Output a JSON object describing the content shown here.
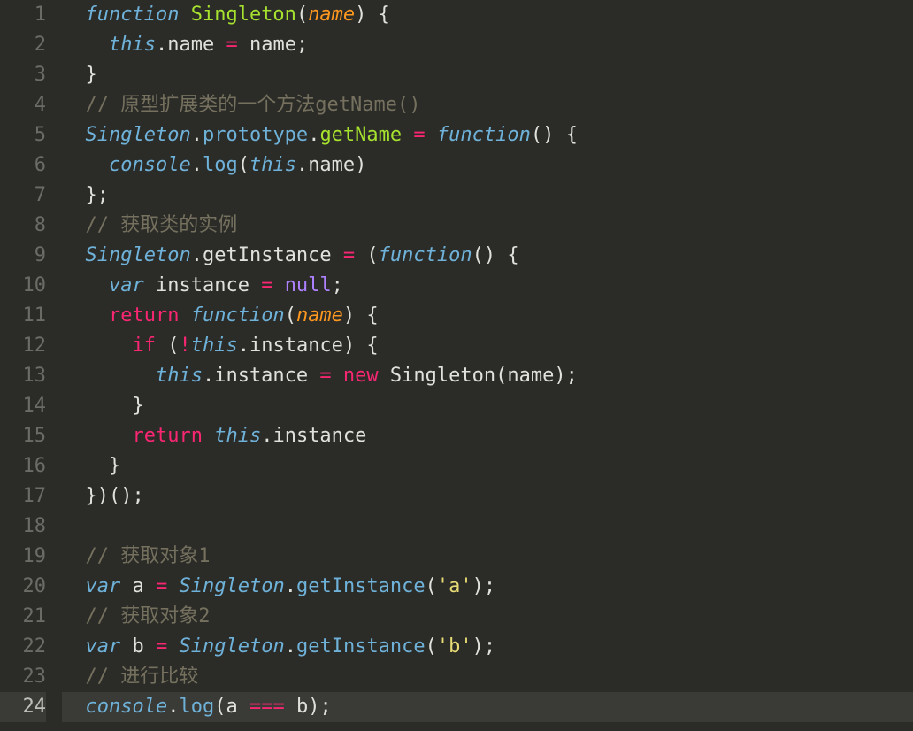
{
  "editor": {
    "active_line": 24,
    "lines": [
      {
        "num": "1",
        "tokens": [
          {
            "text": "  ",
            "class": ""
          },
          {
            "text": "function",
            "class": "kw-storage"
          },
          {
            "text": " ",
            "class": ""
          },
          {
            "text": "Singleton",
            "class": "fn-name"
          },
          {
            "text": "(",
            "class": "punct"
          },
          {
            "text": "name",
            "class": "param"
          },
          {
            "text": ") {",
            "class": "punct"
          }
        ]
      },
      {
        "num": "2",
        "tokens": [
          {
            "text": "    ",
            "class": ""
          },
          {
            "text": "this",
            "class": "this"
          },
          {
            "text": ".",
            "class": "punct"
          },
          {
            "text": "name",
            "class": "prop"
          },
          {
            "text": " ",
            "class": ""
          },
          {
            "text": "=",
            "class": "operator"
          },
          {
            "text": " ",
            "class": ""
          },
          {
            "text": "name",
            "class": "prop"
          },
          {
            "text": ";",
            "class": "punct"
          }
        ]
      },
      {
        "num": "3",
        "tokens": [
          {
            "text": "  }",
            "class": "punct"
          }
        ]
      },
      {
        "num": "4",
        "tokens": [
          {
            "text": "  ",
            "class": ""
          },
          {
            "text": "// 原型扩展类的一个方法getName()",
            "class": "comment"
          }
        ]
      },
      {
        "num": "5",
        "tokens": [
          {
            "text": "  ",
            "class": ""
          },
          {
            "text": "Singleton",
            "class": "var this"
          },
          {
            "text": ".",
            "class": "punct"
          },
          {
            "text": "prototype",
            "class": "call"
          },
          {
            "text": ".",
            "class": "punct"
          },
          {
            "text": "getName",
            "class": "fn-name"
          },
          {
            "text": " ",
            "class": ""
          },
          {
            "text": "=",
            "class": "operator"
          },
          {
            "text": " ",
            "class": ""
          },
          {
            "text": "function",
            "class": "kw-storage"
          },
          {
            "text": "() {",
            "class": "punct"
          }
        ]
      },
      {
        "num": "6",
        "tokens": [
          {
            "text": "    ",
            "class": ""
          },
          {
            "text": "console",
            "class": "var this"
          },
          {
            "text": ".",
            "class": "punct"
          },
          {
            "text": "log",
            "class": "call"
          },
          {
            "text": "(",
            "class": "punct"
          },
          {
            "text": "this",
            "class": "this"
          },
          {
            "text": ".",
            "class": "punct"
          },
          {
            "text": "name",
            "class": "prop"
          },
          {
            "text": ")",
            "class": "punct"
          }
        ]
      },
      {
        "num": "7",
        "tokens": [
          {
            "text": "  };",
            "class": "punct"
          }
        ]
      },
      {
        "num": "8",
        "tokens": [
          {
            "text": "  ",
            "class": ""
          },
          {
            "text": "// 获取类的实例",
            "class": "comment"
          }
        ]
      },
      {
        "num": "9",
        "tokens": [
          {
            "text": "  ",
            "class": ""
          },
          {
            "text": "Singleton",
            "class": "var this"
          },
          {
            "text": ".",
            "class": "punct"
          },
          {
            "text": "getInstance",
            "class": "prop"
          },
          {
            "text": " ",
            "class": ""
          },
          {
            "text": "=",
            "class": "operator"
          },
          {
            "text": " (",
            "class": "punct"
          },
          {
            "text": "function",
            "class": "kw-storage"
          },
          {
            "text": "() {",
            "class": "punct"
          }
        ]
      },
      {
        "num": "10",
        "tokens": [
          {
            "text": "    ",
            "class": ""
          },
          {
            "text": "var",
            "class": "kw-storage"
          },
          {
            "text": " instance ",
            "class": "prop"
          },
          {
            "text": "=",
            "class": "operator"
          },
          {
            "text": " ",
            "class": ""
          },
          {
            "text": "null",
            "class": "null"
          },
          {
            "text": ";",
            "class": "punct"
          }
        ]
      },
      {
        "num": "11",
        "tokens": [
          {
            "text": "    ",
            "class": ""
          },
          {
            "text": "return",
            "class": "kw-flow"
          },
          {
            "text": " ",
            "class": ""
          },
          {
            "text": "function",
            "class": "kw-storage"
          },
          {
            "text": "(",
            "class": "punct"
          },
          {
            "text": "name",
            "class": "param"
          },
          {
            "text": ") {",
            "class": "punct"
          }
        ]
      },
      {
        "num": "12",
        "tokens": [
          {
            "text": "      ",
            "class": ""
          },
          {
            "text": "if",
            "class": "kw-flow"
          },
          {
            "text": " (",
            "class": "punct"
          },
          {
            "text": "!",
            "class": "operator"
          },
          {
            "text": "this",
            "class": "this"
          },
          {
            "text": ".",
            "class": "punct"
          },
          {
            "text": "instance",
            "class": "prop"
          },
          {
            "text": ") {",
            "class": "punct"
          }
        ]
      },
      {
        "num": "13",
        "tokens": [
          {
            "text": "        ",
            "class": ""
          },
          {
            "text": "this",
            "class": "this"
          },
          {
            "text": ".",
            "class": "punct"
          },
          {
            "text": "instance",
            "class": "prop"
          },
          {
            "text": " ",
            "class": ""
          },
          {
            "text": "=",
            "class": "operator"
          },
          {
            "text": " ",
            "class": ""
          },
          {
            "text": "new",
            "class": "kw-flow"
          },
          {
            "text": " ",
            "class": ""
          },
          {
            "text": "Singleton",
            "class": "prop"
          },
          {
            "text": "(",
            "class": "punct"
          },
          {
            "text": "name",
            "class": "prop"
          },
          {
            "text": ");",
            "class": "punct"
          }
        ]
      },
      {
        "num": "14",
        "tokens": [
          {
            "text": "      }",
            "class": "punct"
          }
        ]
      },
      {
        "num": "15",
        "tokens": [
          {
            "text": "      ",
            "class": ""
          },
          {
            "text": "return",
            "class": "kw-flow"
          },
          {
            "text": " ",
            "class": ""
          },
          {
            "text": "this",
            "class": "this"
          },
          {
            "text": ".",
            "class": "punct"
          },
          {
            "text": "instance",
            "class": "prop"
          }
        ]
      },
      {
        "num": "16",
        "tokens": [
          {
            "text": "    }",
            "class": "punct"
          }
        ]
      },
      {
        "num": "17",
        "tokens": [
          {
            "text": "  })();",
            "class": "punct"
          }
        ]
      },
      {
        "num": "18",
        "tokens": []
      },
      {
        "num": "19",
        "tokens": [
          {
            "text": "  ",
            "class": ""
          },
          {
            "text": "// 获取对象1",
            "class": "comment"
          }
        ]
      },
      {
        "num": "20",
        "tokens": [
          {
            "text": "  ",
            "class": ""
          },
          {
            "text": "var",
            "class": "kw-storage"
          },
          {
            "text": " a ",
            "class": "prop"
          },
          {
            "text": "=",
            "class": "operator"
          },
          {
            "text": " ",
            "class": ""
          },
          {
            "text": "Singleton",
            "class": "var this"
          },
          {
            "text": ".",
            "class": "punct"
          },
          {
            "text": "getInstance",
            "class": "call"
          },
          {
            "text": "(",
            "class": "punct"
          },
          {
            "text": "'a'",
            "class": "string"
          },
          {
            "text": ");",
            "class": "punct"
          }
        ]
      },
      {
        "num": "21",
        "tokens": [
          {
            "text": "  ",
            "class": ""
          },
          {
            "text": "// 获取对象2",
            "class": "comment"
          }
        ]
      },
      {
        "num": "22",
        "tokens": [
          {
            "text": "  ",
            "class": ""
          },
          {
            "text": "var",
            "class": "kw-storage"
          },
          {
            "text": " b ",
            "class": "prop"
          },
          {
            "text": "=",
            "class": "operator"
          },
          {
            "text": " ",
            "class": ""
          },
          {
            "text": "Singleton",
            "class": "var this"
          },
          {
            "text": ".",
            "class": "punct"
          },
          {
            "text": "getInstance",
            "class": "call"
          },
          {
            "text": "(",
            "class": "punct"
          },
          {
            "text": "'b'",
            "class": "string"
          },
          {
            "text": ");",
            "class": "punct"
          }
        ]
      },
      {
        "num": "23",
        "tokens": [
          {
            "text": "  ",
            "class": ""
          },
          {
            "text": "// 进行比较",
            "class": "comment"
          }
        ]
      },
      {
        "num": "24",
        "tokens": [
          {
            "text": "  ",
            "class": ""
          },
          {
            "text": "console",
            "class": "var this"
          },
          {
            "text": ".",
            "class": "punct"
          },
          {
            "text": "log",
            "class": "call"
          },
          {
            "text": "(",
            "class": "punct"
          },
          {
            "text": "a ",
            "class": "prop"
          },
          {
            "text": "===",
            "class": "operator"
          },
          {
            "text": " b",
            "class": "prop"
          },
          {
            "text": ");",
            "class": "punct"
          }
        ]
      }
    ]
  }
}
